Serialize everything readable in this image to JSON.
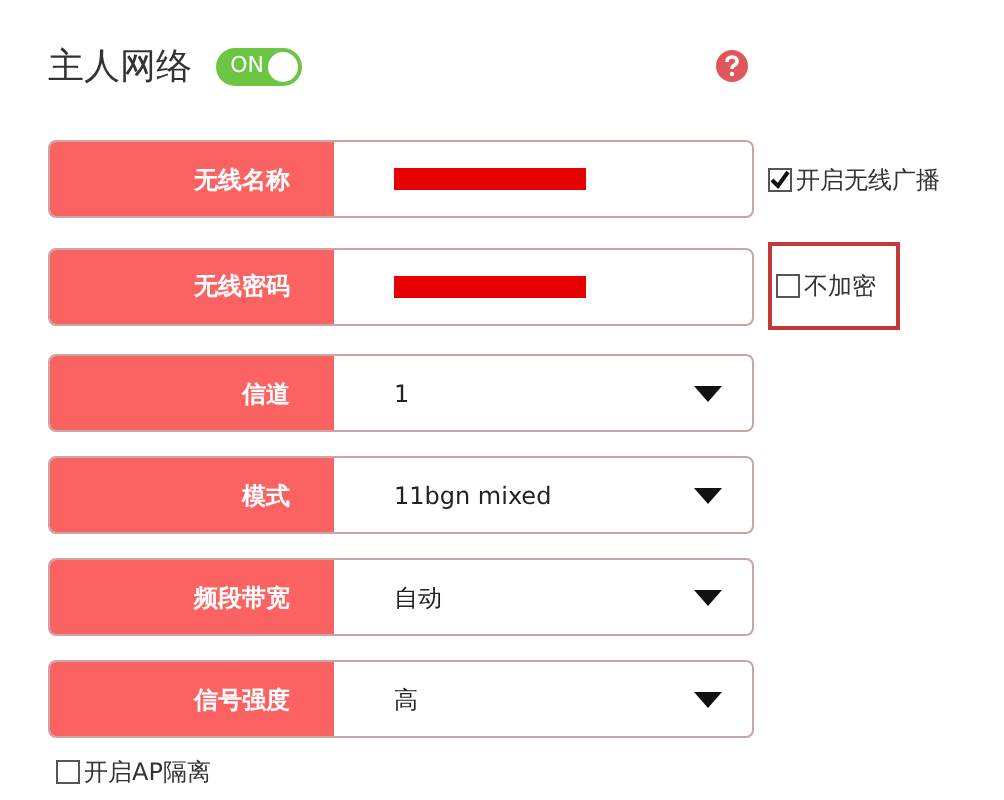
{
  "header": {
    "title": "主人网络",
    "toggle": {
      "label": "ON",
      "on": true
    }
  },
  "fields": [
    {
      "kind": "text",
      "label": "无线名称",
      "redacted": true,
      "side": {
        "label": "开启无线广播",
        "checked": true,
        "highlighted": false
      }
    },
    {
      "kind": "text",
      "label": "无线密码",
      "redacted": true,
      "side": {
        "label": "不加密",
        "checked": false,
        "highlighted": true
      }
    },
    {
      "kind": "select",
      "label": "信道",
      "value": "1"
    },
    {
      "kind": "select",
      "label": "模式",
      "value": "11bgn mixed"
    },
    {
      "kind": "select",
      "label": "频段带宽",
      "value": "自动"
    },
    {
      "kind": "select",
      "label": "信号强度",
      "value": "高"
    }
  ],
  "ap_isolation": {
    "label": "开启AP隔离",
    "checked": false
  }
}
